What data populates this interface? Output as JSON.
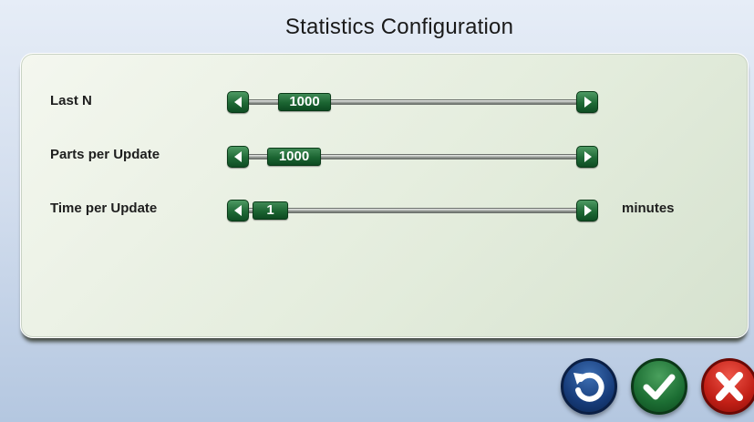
{
  "header": {
    "title": "Statistics Configuration"
  },
  "settings": [
    {
      "label": "Last N",
      "value": "1000",
      "unit": ""
    },
    {
      "label": "Parts per Update",
      "value": "1000",
      "unit": ""
    },
    {
      "label": "Time per Update",
      "value": "1",
      "unit": "minutes"
    }
  ],
  "colors": {
    "accent_green": "#1b6431",
    "reset_blue": "#173c7a",
    "cancel_red": "#c21f16",
    "panel": "#e3ecdc"
  },
  "icons": {
    "decrease": "arrow-left-icon",
    "increase": "arrow-right-icon",
    "reset": "undo-icon",
    "confirm": "checkmark-icon",
    "cancel": "x-icon"
  }
}
